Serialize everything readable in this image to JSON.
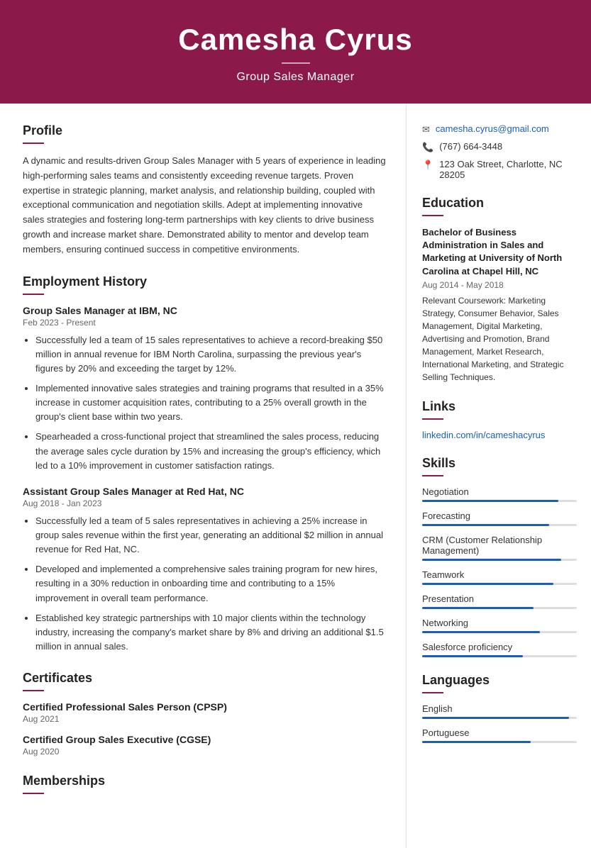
{
  "header": {
    "name": "Camesha Cyrus",
    "title": "Group Sales Manager"
  },
  "contact": {
    "email": "camesha.cyrus@gmail.com",
    "phone": "(767) 664-3448",
    "address": "123 Oak Street, Charlotte, NC 28205"
  },
  "profile": {
    "section_title": "Profile",
    "text": "A dynamic and results-driven Group Sales Manager with 5 years of experience in leading high-performing sales teams and consistently exceeding revenue targets. Proven expertise in strategic planning, market analysis, and relationship building, coupled with exceptional communication and negotiation skills. Adept at implementing innovative sales strategies and fostering long-term partnerships with key clients to drive business growth and increase market share. Demonstrated ability to mentor and develop team members, ensuring continued success in competitive environments."
  },
  "employment": {
    "section_title": "Employment History",
    "jobs": [
      {
        "title": "Group Sales Manager at IBM, NC",
        "date": "Feb 2023 - Present",
        "bullets": [
          "Successfully led a team of 15 sales representatives to achieve a record-breaking $50 million in annual revenue for IBM North Carolina, surpassing the previous year's figures by 20% and exceeding the target by 12%.",
          "Implemented innovative sales strategies and training programs that resulted in a 35% increase in customer acquisition rates, contributing to a 25% overall growth in the group's client base within two years.",
          "Spearheaded a cross-functional project that streamlined the sales process, reducing the average sales cycle duration by 15% and increasing the group's efficiency, which led to a 10% improvement in customer satisfaction ratings."
        ]
      },
      {
        "title": "Assistant Group Sales Manager at Red Hat, NC",
        "date": "Aug 2018 - Jan 2023",
        "bullets": [
          "Successfully led a team of 5 sales representatives in achieving a 25% increase in group sales revenue within the first year, generating an additional $2 million in annual revenue for Red Hat, NC.",
          "Developed and implemented a comprehensive sales training program for new hires, resulting in a 30% reduction in onboarding time and contributing to a 15% improvement in overall team performance.",
          "Established key strategic partnerships with 10 major clients within the technology industry, increasing the company's market share by 8% and driving an additional $1.5 million in annual sales."
        ]
      }
    ]
  },
  "certificates": {
    "section_title": "Certificates",
    "items": [
      {
        "title": "Certified Professional Sales Person (CPSP)",
        "date": "Aug 2021"
      },
      {
        "title": "Certified Group Sales Executive (CGSE)",
        "date": "Aug 2020"
      }
    ]
  },
  "memberships": {
    "section_title": "Memberships"
  },
  "education": {
    "section_title": "Education",
    "degree": "Bachelor of Business Administration in Sales and Marketing at University of North Carolina at Chapel Hill, NC",
    "date": "Aug 2014 - May 2018",
    "coursework": "Relevant Coursework: Marketing Strategy, Consumer Behavior, Sales Management, Digital Marketing, Advertising and Promotion, Brand Management, Market Research, International Marketing, and Strategic Selling Techniques."
  },
  "links": {
    "section_title": "Links",
    "linkedin": "linkedin.com/in/cameshacyrus"
  },
  "skills": {
    "section_title": "Skills",
    "items": [
      {
        "name": "Negotiation",
        "percent": 88
      },
      {
        "name": "Forecasting",
        "percent": 82
      },
      {
        "name": "CRM (Customer Relationship Management)",
        "percent": 90
      },
      {
        "name": "Teamwork",
        "percent": 85
      },
      {
        "name": "Presentation",
        "percent": 72
      },
      {
        "name": "Networking",
        "percent": 76
      },
      {
        "name": "Salesforce proficiency",
        "percent": 65
      }
    ]
  },
  "languages": {
    "section_title": "Languages",
    "items": [
      {
        "name": "English",
        "percent": 95
      },
      {
        "name": "Portuguese",
        "percent": 70
      }
    ]
  }
}
